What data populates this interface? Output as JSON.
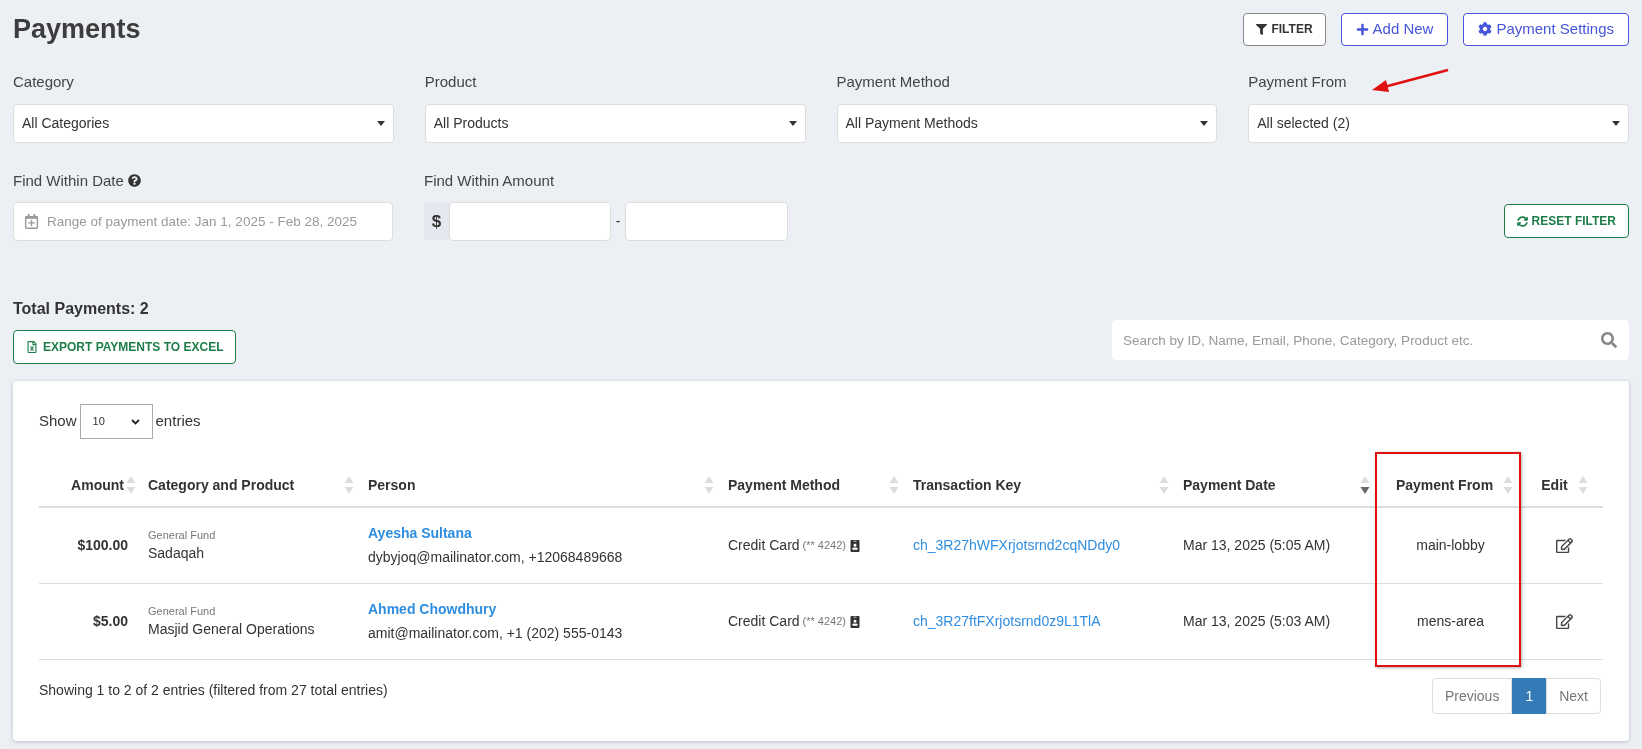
{
  "title": "Payments",
  "actions": [
    {
      "label": "FILTER",
      "kind": "filter"
    },
    {
      "label": "Add New",
      "kind": "add"
    },
    {
      "label": "Payment Settings",
      "kind": "settings"
    }
  ],
  "filters": [
    {
      "label": "Category",
      "value": "All Categories"
    },
    {
      "label": "Product",
      "value": "All Products"
    },
    {
      "label": "Payment Method",
      "value": "All Payment Methods"
    },
    {
      "label": "Payment From",
      "value": "All selected (2)"
    }
  ],
  "date_filter": {
    "label": "Find Within Date",
    "placeholder": "Range of payment date: Jan 1, 2025 - Feb 28, 2025"
  },
  "amount_filter": {
    "label": "Find Within Amount",
    "currency": "$",
    "separator": "-"
  },
  "reset_button": "RESET FILTER",
  "total": "Total Payments: 2",
  "export_button": "EXPORT PAYMENTS TO EXCEL",
  "search": {
    "placeholder": "Search by ID, Name, Email, Phone, Category, Product etc."
  },
  "table": {
    "show_label": "Show",
    "page_size": "10",
    "entries_label": "entries",
    "columns": [
      {
        "label": "Amount",
        "sorted_desc": false
      },
      {
        "label": "Category and Product",
        "sorted_desc": false
      },
      {
        "label": "Person",
        "sorted_desc": false
      },
      {
        "label": "Payment Method",
        "sorted_desc": false
      },
      {
        "label": "Transaction Key",
        "sorted_desc": false
      },
      {
        "label": "Payment Date",
        "sorted_desc": true
      },
      {
        "label": "Payment From",
        "sorted_desc": false
      },
      {
        "label": "Edit",
        "sorted_desc": false
      }
    ],
    "rows": [
      {
        "amount": "$100.00",
        "category": "General Fund",
        "product": "Sadaqah",
        "name": "Ayesha Sultana",
        "contact": "dybyjoq@mailinator.com, +12068489668",
        "method": "Credit Card",
        "card": "(** 4242)",
        "key": "ch_3R27hWFXrjotsrnd2cqNDdy0",
        "date": "Mar 13, 2025 (5:05 AM)",
        "from": "main-lobby"
      },
      {
        "amount": "$5.00",
        "category": "General Fund",
        "product": "Masjid General Operations",
        "name": "Ahmed Chowdhury",
        "contact": "amit@mailinator.com, +1 (202) 555-0143",
        "method": "Credit Card",
        "card": "(** 4242)",
        "key": "ch_3R27ftFXrjotsrnd0z9L1TlA",
        "date": "Mar 13, 2025 (5:03 AM)",
        "from": "mens-area"
      }
    ],
    "info": "Showing 1 to 2 of 2 entries (filtered from 27 total entries)",
    "pagination": [
      {
        "label": "Previous",
        "selected": false
      },
      {
        "label": "1",
        "selected": true
      },
      {
        "label": "Next",
        "selected": false
      }
    ]
  }
}
